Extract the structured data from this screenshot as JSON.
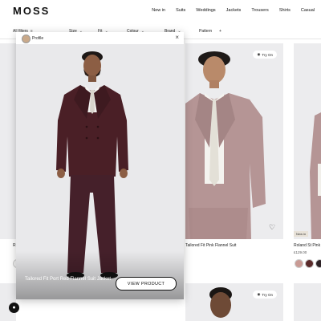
{
  "header": {
    "logo": "MOSS",
    "nav": [
      "New in",
      "Suits",
      "Weddings",
      "Jackets",
      "Trousers",
      "Shirts",
      "Casual"
    ]
  },
  "filters": {
    "all_filters": "All filters",
    "size": "Size",
    "fit": "Fit",
    "colour": "Colour",
    "brand": "Brand",
    "pattern": "Pattern",
    "plus": "+"
  },
  "modal": {
    "profile_label": "Profile",
    "close": "×",
    "product_title": "Tailored Fit Port Red Flannel Suit Jacket",
    "view_button": "VIEW PRODUCT"
  },
  "products": [
    {
      "title": "Tailored Fit Pink Flannel Suit",
      "try_on": "Try On",
      "colors": {
        "jacket": "#b08f8f",
        "shirt": "#f3f2ef",
        "tie": "#e4e1d9",
        "background": "#ececee"
      }
    },
    {
      "title": "Roland St Pink",
      "price": "£129.00",
      "badge": "New in",
      "swatches": [
        "#c99b95",
        "#5a2a2a",
        "#2d2226"
      ]
    }
  ],
  "bottom_cards": {
    "try_on": "Try On"
  },
  "colors": {
    "modal_suit": "#4a1f26",
    "text": "#111111",
    "page_bg": "#ffffff"
  }
}
